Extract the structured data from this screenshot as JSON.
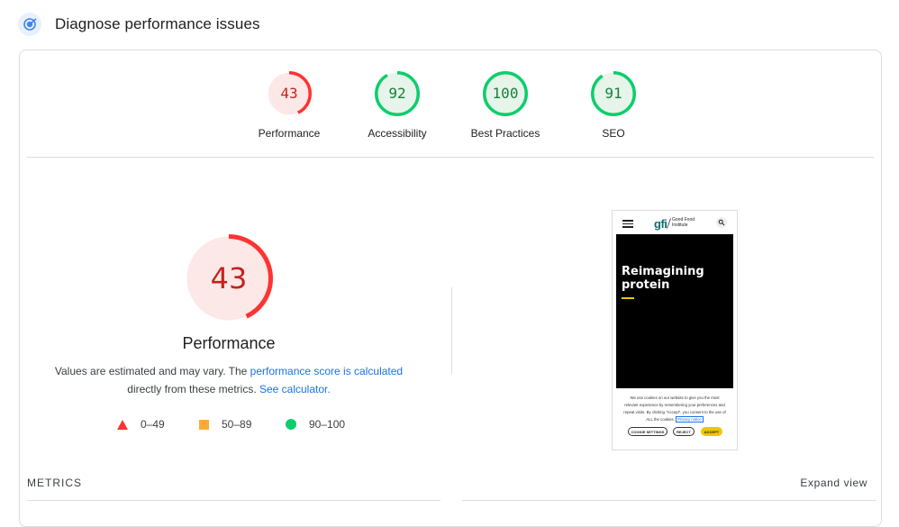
{
  "header": {
    "title": "Diagnose performance issues",
    "icon": "lighthouse-icon"
  },
  "gauges": [
    {
      "label": "Performance",
      "score": "43",
      "value": 43,
      "status": "fail",
      "color": "#ff3333",
      "text_color": "#c5221f",
      "fill": "#fce8e6"
    },
    {
      "label": "Accessibility",
      "score": "92",
      "value": 92,
      "status": "pass",
      "color": "#0cce6b",
      "text_color": "#188038",
      "fill": "#e6f4ea"
    },
    {
      "label": "Best Practices",
      "score": "100",
      "value": 100,
      "status": "pass",
      "color": "#0cce6b",
      "text_color": "#188038",
      "fill": "#e6f4ea"
    },
    {
      "label": "SEO",
      "score": "91",
      "value": 91,
      "status": "pass",
      "color": "#0cce6b",
      "text_color": "#188038",
      "fill": "#e6f4ea"
    }
  ],
  "main": {
    "score": "43",
    "value": 43,
    "title": "Performance",
    "desc_prefix": "Values are estimated and may vary. The ",
    "desc_link": "performance score is calculated",
    "desc_middle": " directly from these metrics. ",
    "calc_link": "See calculator."
  },
  "legend": [
    {
      "shape": "triangle",
      "label": "0–49",
      "color": "#ff3333"
    },
    {
      "shape": "square",
      "label": "50–89",
      "color": "#ffaa33"
    },
    {
      "shape": "circle",
      "label": "90–100",
      "color": "#0cce6b"
    }
  ],
  "screenshot": {
    "logo": "gfi",
    "logo_text": "Good Food Institute",
    "hero_title": "Reimagining protein",
    "cookie_text": "We use cookies on our website to give you the most relevant experience by remembering your preferences and repeat visits. By clicking \"Accept\", you consent to the use of ALL the cookies.",
    "privacy_link": "Privacy notice",
    "buttons": {
      "settings": "COOKIE SETTINGS",
      "reject": "REJECT",
      "accept": "ACCEPT"
    }
  },
  "metrics": {
    "label": "METRICS",
    "expand": "Expand view"
  }
}
